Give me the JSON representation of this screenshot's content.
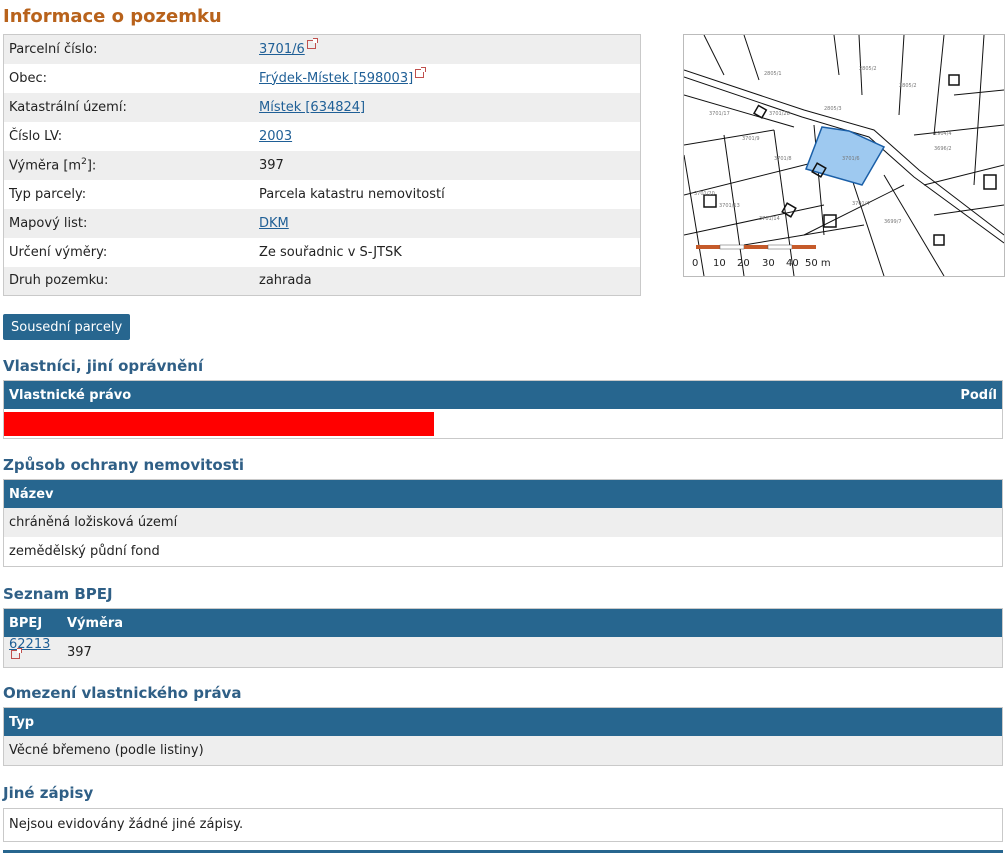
{
  "title": "Informace o pozemku",
  "info_rows": [
    {
      "label": "Parcelní číslo:",
      "value": "3701/6",
      "link": true,
      "ext": true
    },
    {
      "label": "Obec:",
      "value": "Frýdek-Místek [598003]",
      "link": true,
      "ext": true
    },
    {
      "label": "Katastrální území:",
      "value": "Místek [634824]",
      "link": true,
      "ext": false
    },
    {
      "label": "Číslo LV:",
      "value": "2003",
      "link": true,
      "ext": false
    },
    {
      "label_prefix": "Výměra [m",
      "label_sup": "2",
      "label_suffix": "]:",
      "value": "397",
      "link": false
    },
    {
      "label": "Typ parcely:",
      "value": "Parcela katastru nemovitostí",
      "link": false
    },
    {
      "label": "Mapový list:",
      "value": "DKM",
      "link": true,
      "ext": false
    },
    {
      "label": "Určení výměry:",
      "value": "Ze souřadnic v S-JTSK",
      "link": false
    },
    {
      "label": "Druh pozemku:",
      "value": "zahrada",
      "link": false
    }
  ],
  "map": {
    "scale_labels": [
      "0",
      "10",
      "20",
      "30",
      "40",
      "50 m"
    ],
    "highlight_color": "#9ec9f0"
  },
  "neighbors_button": "Sousední parcely",
  "owners": {
    "heading": "Vlastníci, jiní oprávnění",
    "col_left": "Vlastnické právo",
    "col_right": "Podíl"
  },
  "protection": {
    "heading": "Způsob ochrany nemovitosti",
    "col": "Název",
    "rows": [
      "chráněná ložisková území",
      "zemědělský půdní fond"
    ]
  },
  "bpej": {
    "heading": "Seznam BPEJ",
    "col1": "BPEJ",
    "col2": "Výměra",
    "code": "62213",
    "area": "397"
  },
  "restrictions": {
    "heading": "Omezení vlastnického práva",
    "col": "Typ",
    "rows": [
      "Věcné břemeno (podle listiny)"
    ]
  },
  "other": {
    "heading": "Jiné zápisy",
    "text": "Nejsou evidovány žádné jiné zápisy."
  }
}
